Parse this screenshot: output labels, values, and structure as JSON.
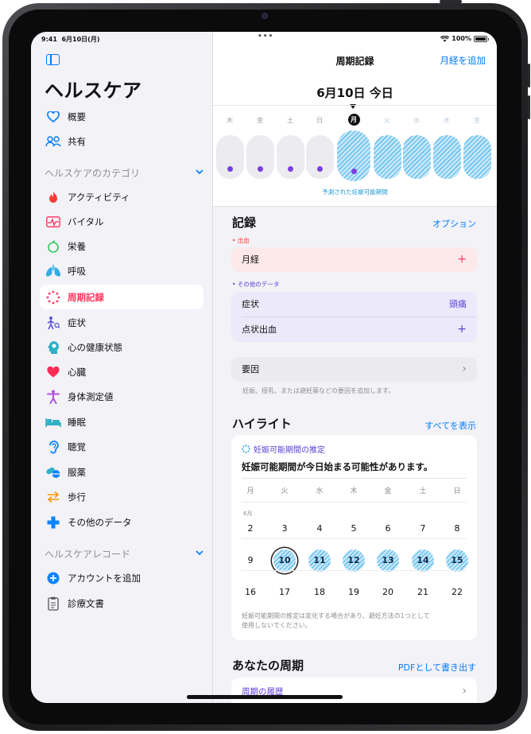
{
  "status_bar": {
    "time": "9:41",
    "date": "6月10日(月)",
    "dots": "•••",
    "battery": "100%"
  },
  "sidebar": {
    "title": "ヘルスケア",
    "top_items": [
      {
        "label": "概要",
        "icon": "heart-outline-icon"
      },
      {
        "label": "共有",
        "icon": "people-icon"
      }
    ],
    "categories_header": "ヘルスケアのカテゴリ",
    "categories": [
      {
        "label": "アクティビティ",
        "icon": "flame-icon",
        "color": "#ff3b30"
      },
      {
        "label": "バイタル",
        "icon": "vitals-icon",
        "color": "#ff2d55"
      },
      {
        "label": "栄養",
        "icon": "apple-icon",
        "color": "#34c759"
      },
      {
        "label": "呼吸",
        "icon": "lungs-icon",
        "color": "#32ade6"
      },
      {
        "label": "周期記録",
        "icon": "cycle-tracking-icon",
        "color": "#ff375f",
        "selected": true
      },
      {
        "label": "症状",
        "icon": "symptoms-icon",
        "color": "#5856d6"
      },
      {
        "label": "心の健康状態",
        "icon": "mind-icon",
        "color": "#30b0c7"
      },
      {
        "label": "心臓",
        "icon": "heart-icon",
        "color": "#ff2d55"
      },
      {
        "label": "身体測定値",
        "icon": "body-icon",
        "color": "#af52de"
      },
      {
        "label": "睡眠",
        "icon": "bed-icon",
        "color": "#30b0c7"
      },
      {
        "label": "聴覚",
        "icon": "ear-icon",
        "color": "#0a84ff"
      },
      {
        "label": "服薬",
        "icon": "pills-icon",
        "color": "#30b0c7"
      },
      {
        "label": "歩行",
        "icon": "arrows-icon",
        "color": "#ff9500"
      },
      {
        "label": "その他のデータ",
        "icon": "plus-cross-icon",
        "color": "#0a84ff"
      }
    ],
    "records_header": "ヘルスケアレコード",
    "records": [
      {
        "label": "アカウントを追加",
        "icon": "plus-circle-icon"
      },
      {
        "label": "診療文書",
        "icon": "clipboard-icon"
      }
    ]
  },
  "main": {
    "nav_title": "周期記録",
    "nav_add": "月経を追加",
    "date_header": "6月10日 今日",
    "week_days": [
      {
        "label": "木",
        "dot": true,
        "fertile": false
      },
      {
        "label": "金",
        "dot": true,
        "fertile": false
      },
      {
        "label": "土",
        "dot": true,
        "fertile": false
      },
      {
        "label": "日",
        "dot": true,
        "fertile": false
      },
      {
        "label": "月",
        "dot": true,
        "fertile": true,
        "today": true
      },
      {
        "label": "火",
        "dot": false,
        "fertile": true
      },
      {
        "label": "水",
        "dot": false,
        "fertile": true
      },
      {
        "label": "木",
        "dot": false,
        "fertile": true
      },
      {
        "label": "金",
        "dot": false,
        "fertile": true
      }
    ],
    "fertile_caption": "予測された妊娠可能期間",
    "records_section": {
      "title": "記録",
      "option": "オプション",
      "bleeding_label": "• 出血",
      "period_row": "月経",
      "period_plus": "+",
      "other_label": "• その他のデータ",
      "symptom_row": "症状",
      "symptom_value": "頭痛",
      "spotting_row": "点状出血",
      "spotting_plus": "+",
      "factors_row": "要因",
      "factors_chevron": "›",
      "factors_hint": "妊娠、授乳、または避妊薬などの要因を追加します。"
    },
    "highlights": {
      "title": "ハイライト",
      "show_all": "すべてを表示",
      "card_title": "妊娠可能期間の推定",
      "card_subtitle": "妊娠可能期間が今日始まる可能性があります。",
      "weekdays": [
        "月",
        "火",
        "水",
        "木",
        "金",
        "土",
        "日"
      ],
      "month_label": "6月",
      "weeks": [
        [
          "2",
          "3",
          "4",
          "5",
          "6",
          "7",
          "8"
        ],
        [
          "9",
          "10",
          "11",
          "12",
          "13",
          "14",
          "15"
        ],
        [
          "16",
          "17",
          "18",
          "19",
          "20",
          "21",
          "22"
        ]
      ],
      "fertile_days": [
        "10",
        "11",
        "12",
        "13",
        "14",
        "15"
      ],
      "today": "10",
      "disclaimer_line1": "妊娠可能期間の推定は変化する場合があり、避妊方法の1つとして",
      "disclaimer_line2": "使用しないでください。"
    },
    "your_cycles": {
      "title": "あなたの周期",
      "export": "PDFとして書き出す",
      "history_row": "周期の履歴",
      "chevron": "›"
    }
  },
  "colors": {
    "accent": "#007aff",
    "cycle": "#ff375f",
    "fertile": "#6ec3f0",
    "dot": "#7a3fe0"
  }
}
